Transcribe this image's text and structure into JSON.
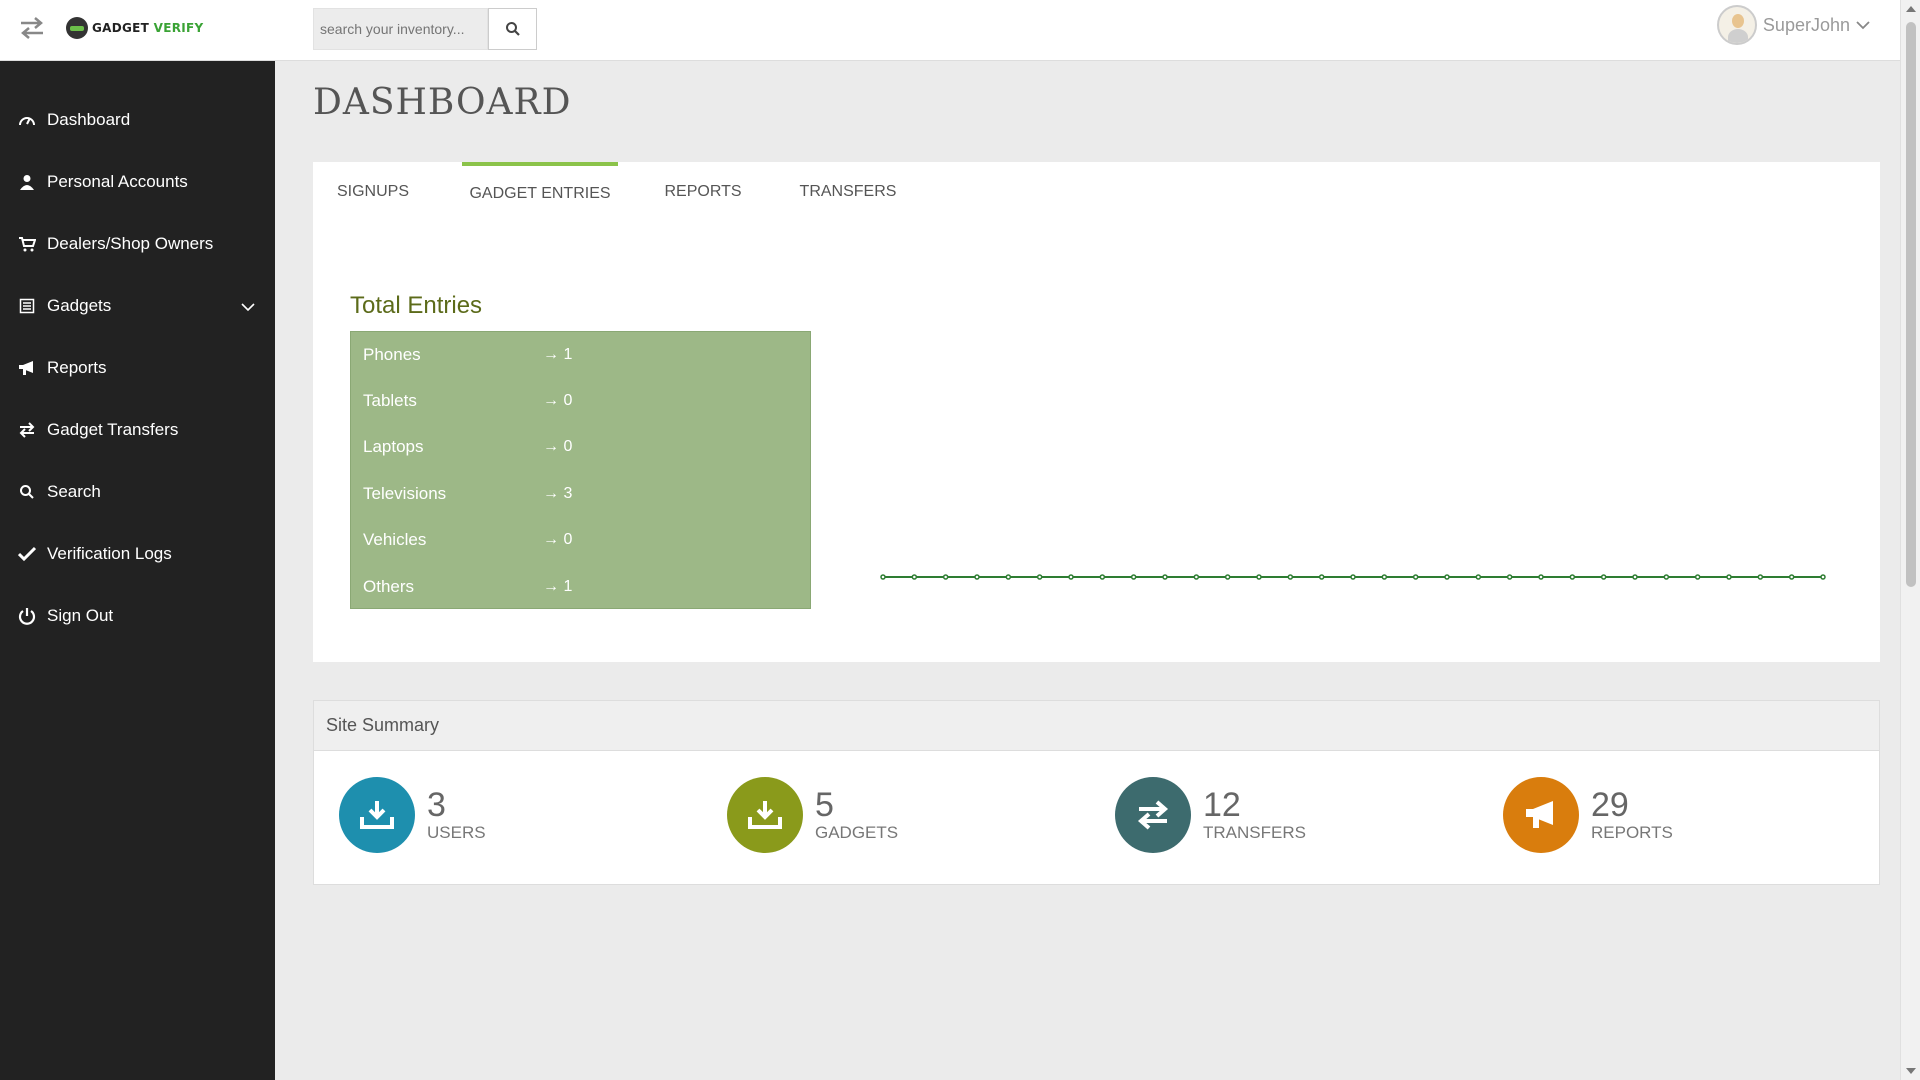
{
  "header": {
    "logo_text_gadget": "GADGET",
    "logo_text_verify": "VERIFY",
    "search_placeholder": "search your inventory...",
    "username": "SuperJohn"
  },
  "sidebar": {
    "items": [
      {
        "label": "Dashboard",
        "icon": "dashboard-icon"
      },
      {
        "label": "Personal Accounts",
        "icon": "user-icon"
      },
      {
        "label": "Dealers/Shop Owners",
        "icon": "cart-icon"
      },
      {
        "label": "Gadgets",
        "icon": "list-icon"
      },
      {
        "label": "Reports",
        "icon": "megaphone-icon"
      },
      {
        "label": "Gadget Transfers",
        "icon": "transfer-icon"
      },
      {
        "label": "Search",
        "icon": "search-icon"
      },
      {
        "label": "Verification Logs",
        "icon": "check-icon"
      },
      {
        "label": "Sign Out",
        "icon": "power-icon"
      }
    ]
  },
  "page": {
    "title": "DASHBOARD"
  },
  "tabs": [
    {
      "label": "SIGNUPS",
      "active": false
    },
    {
      "label": "GADGET ENTRIES",
      "active": true
    },
    {
      "label": "REPORTS",
      "active": false
    },
    {
      "label": "TRANSFERS",
      "active": false
    }
  ],
  "entries": {
    "title": "Total Entries",
    "rows": [
      {
        "label": "Phones",
        "value": "→ 1"
      },
      {
        "label": "Tablets",
        "value": "→ 0"
      },
      {
        "label": "Laptops",
        "value": "→ 0"
      },
      {
        "label": "Televisions",
        "value": "→ 3"
      },
      {
        "label": "Vehicles",
        "value": "→ 0"
      },
      {
        "label": "Others",
        "value": "→ 1"
      }
    ]
  },
  "chart_data": {
    "type": "line",
    "values": [
      0,
      0,
      0,
      0,
      0,
      0,
      0,
      0,
      0,
      0,
      0,
      0,
      0,
      0,
      0,
      0,
      0,
      0,
      0,
      0,
      0,
      0,
      0,
      0,
      0,
      0,
      0,
      0,
      0,
      0,
      0
    ],
    "color": "#2e7d32"
  },
  "summary": {
    "title": "Site Summary",
    "stats": [
      {
        "value": "3",
        "label": "USERS",
        "color": "#1e8fae",
        "icon": "download-icon"
      },
      {
        "value": "5",
        "label": "GADGETS",
        "color": "#8a9a1b",
        "icon": "download-icon"
      },
      {
        "value": "12",
        "label": "TRANSFERS",
        "color": "#3d6b6e",
        "icon": "transfer-icon"
      },
      {
        "value": "29",
        "label": "REPORTS",
        "color": "#d97d0d",
        "icon": "megaphone-icon"
      }
    ]
  },
  "colors": {
    "sidebar_bg": "#222222",
    "accent": "#8bc34a",
    "entries_bg": "#9db887"
  }
}
